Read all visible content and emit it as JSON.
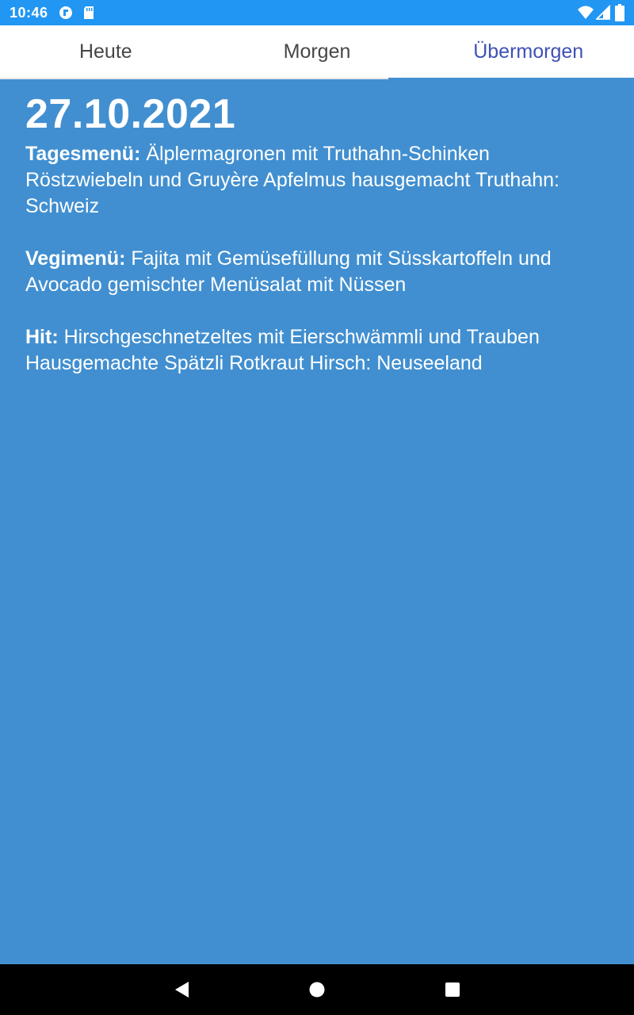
{
  "status_bar": {
    "time": "10:46",
    "icons": [
      "app-notification-icon",
      "sd-card-icon",
      "wifi-icon",
      "signal-icon",
      "battery-icon"
    ]
  },
  "tabs": [
    {
      "label": "Heute",
      "selected": false
    },
    {
      "label": "Morgen",
      "selected": false
    },
    {
      "label": "Übermorgen",
      "selected": true
    }
  ],
  "content": {
    "date": "27.10.2021",
    "menus": [
      {
        "label": "Tagesmenü:",
        "text": " Älplermagronen mit Truthahn-Schinken Röstzwiebeln und Gruyère Apfelmus hausgemacht Truthahn: Schweiz"
      },
      {
        "label": "Vegimenü:",
        "text": " Fajita mit Gemüsefüllung mit Süsskartoffeln und Avocado gemischter Menüsalat mit Nüssen"
      },
      {
        "label": "Hit:",
        "text": " Hirschgeschnetzeltes mit Eierschwämmli und Trauben Hausgemachte Spätzli Rotkraut Hirsch: Neuseeland"
      }
    ]
  },
  "navigation": {
    "buttons": [
      "back-icon",
      "home-icon",
      "recents-icon"
    ]
  },
  "colors": {
    "status_bar": "#2196f3",
    "background": "#418fd0",
    "tab_selected": "#3f51b5",
    "tab_text": "#474747",
    "nav_bar": "#000000"
  }
}
